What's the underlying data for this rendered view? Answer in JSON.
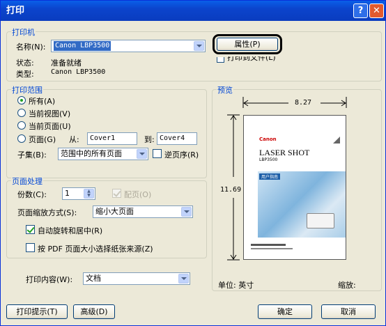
{
  "window": {
    "title": "打印",
    "help_label": "?",
    "close_label": "✕"
  },
  "printer": {
    "group_label": "打印机",
    "name_label": "名称(N):",
    "name_value": "Canon LBP3500",
    "properties_label": "属性(P)",
    "status_label": "状态:",
    "status_value": "准备就绪",
    "type_label": "类型:",
    "type_value": "Canon LBP3500",
    "print_to_file_label": "打印到文件(L)"
  },
  "range": {
    "group_label": "打印范围",
    "all_label": "所有(A)",
    "current_view_label": "当前视图(V)",
    "current_page_label": "当前页面(U)",
    "pages_label": "页面(G)",
    "from_label": "从:",
    "from_value": "Cover1",
    "to_label": "到:",
    "to_value": "Cover4",
    "subset_label": "子集(B):",
    "subset_value": "范围中的所有页面",
    "reverse_label": "逆页序(R)"
  },
  "handling": {
    "group_label": "页面处理",
    "copies_label": "份数(C):",
    "copies_value": "1",
    "collate_label": "配页(O)",
    "scaling_label": "页面缩放方式(S):",
    "scaling_value": "缩小大页面",
    "autorotate_label": "自动旋转和居中(R)",
    "choose_source_label": "按 PDF 页面大小选择纸张来源(Z)"
  },
  "content": {
    "label": "打印内容(W):",
    "value": "文档"
  },
  "preview": {
    "group_label": "预览",
    "width_value": "8.27",
    "height_value": "11.69",
    "unit_label": "单位: 英寸",
    "zoom_label": "缩放:",
    "doc_brand": "Canon",
    "doc_title": "LASER SHOT",
    "doc_model": "LBP3500",
    "doc_section": "用户指南"
  },
  "buttons": {
    "tips": "打印提示(T)",
    "advanced": "高级(D)",
    "ok": "确定",
    "cancel": "取消"
  }
}
